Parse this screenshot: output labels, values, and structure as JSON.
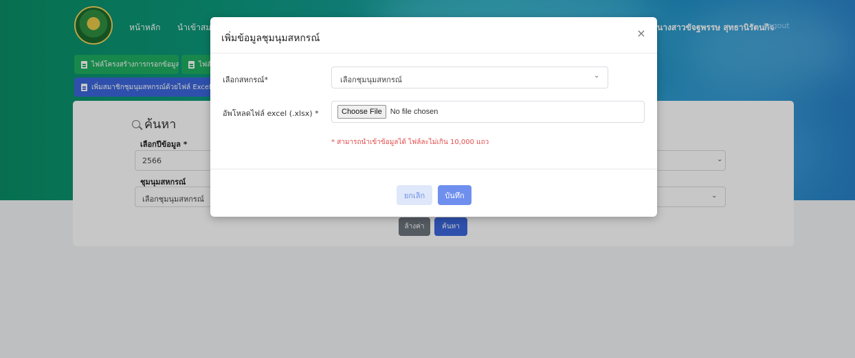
{
  "header": {
    "nav_home": "หน้าหลัก",
    "nav_import": "นำเข้าสมาชิ",
    "user_name": "นางสาวขัจฐพรรษ สุทธานิรัตนกิจ",
    "logout": "Logout"
  },
  "toolbar": {
    "template_button": "ไฟล์โครงสร้างการกรอกข้อมูล",
    "second_button": "ไฟล์",
    "import_excel_button": "เพิ่มสมาชิกชุมนุมสหกรณ์ด้วยไฟล์ Excel"
  },
  "search": {
    "title": "ค้นหา",
    "year_label": "เลือกปีข้อมูล *",
    "year_value": "2566",
    "assembly_label": "ชุมนุมสหกรณ์",
    "assembly_value": "เลือกชุมนุมสหกรณ์",
    "clear_button": "ล้างค่า",
    "search_button": "ค้นหา"
  },
  "modal": {
    "title": "เพิ่มข้อมูลชุมนุมสหกรณ์",
    "close_symbol": "×",
    "select_label": "เลือกสหกรณ์*",
    "select_value": "เลือกชุมนุมสหกรณ์",
    "upload_label": "อัพโหลดไฟล์ excel (.xlsx) *",
    "choose_file": "Choose File",
    "no_file": "No file chosen",
    "note": "* สามารถนำเข้าข้อมูลได้ ไฟล์ละไม่เกิน 10,000 แถว",
    "cancel_button": "ยกเลิก",
    "save_button": "บันทึก"
  },
  "icons": {
    "close": "close-icon",
    "search": "search-icon",
    "chevron": "chevron-down-icon",
    "file": "file-excel-icon"
  },
  "colors": {
    "primary": "#3b67dd",
    "success": "#1fae62",
    "danger": "#e24a4a"
  }
}
